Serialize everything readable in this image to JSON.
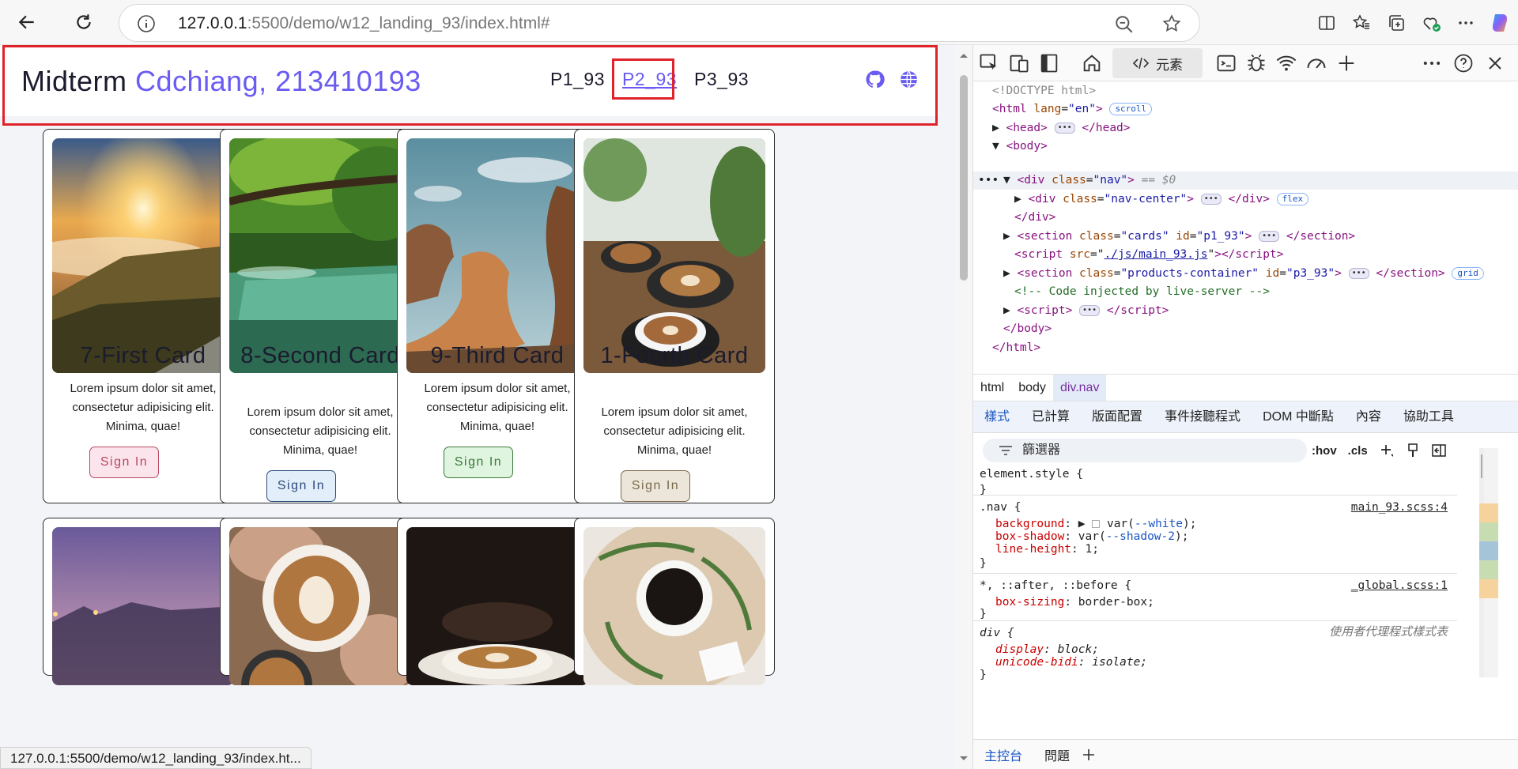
{
  "browser": {
    "url_host": "127.0.0.1",
    "url_rest": ":5500/demo/w12_landing_93/index.html#",
    "status_url": "127.0.0.1:5500/demo/w12_landing_93/index.ht..."
  },
  "page": {
    "brand_prefix": "Midterm",
    "brand_accent": "Cdchiang, 213410193",
    "nav_links": [
      "P1_93",
      "P2_93",
      "P3_93"
    ],
    "active_link": "P2_93",
    "accent_color": "#6a5bf2",
    "cards": [
      {
        "title": "7-First Card",
        "desc": "Lorem ipsum dolor sit amet, consectetur adipisicing elit. Minima, quae!",
        "button": "Sign In",
        "button_color": "#fbe4ec"
      },
      {
        "title": "8-Second Card",
        "desc": "Lorem ipsum dolor sit amet, consectetur adipisicing elit. Minima, quae!",
        "button": "Sign In",
        "button_color": "#e3eefb"
      },
      {
        "title": "9-Third Card",
        "desc": "Lorem ipsum dolor sit amet, consectetur adipisicing elit. Minima, quae!",
        "button": "Sign In",
        "button_color": "#e0f5e0"
      },
      {
        "title": "1-Fourth Card",
        "desc": "Lorem ipsum dolor sit amet, consectetur adipisicing elit. Minima, quae!",
        "button": "Sign In",
        "button_color": "#ece6da"
      }
    ]
  },
  "devtools": {
    "tab_elements": "元素",
    "tree": {
      "doctype": "<!DOCTYPE html>",
      "html_open_tag": "html",
      "html_lang_attr": "lang",
      "html_lang_val": "\"en\"",
      "badge_scroll": "scroll",
      "head": "head",
      "body": "body",
      "div_nav_class": "\"nav\"",
      "eq_s0": "== $0",
      "nav_center_class": "\"nav-center\"",
      "badge_flex": "flex",
      "section_cards_class": "\"cards\"",
      "section_cards_id": "\"p1_93\"",
      "script_src": "./js/main_93.js",
      "section_products_class": "\"products-container\"",
      "section_products_id": "\"p3_93\"",
      "badge_grid": "grid",
      "comment": "<!-- Code injected by live-server -->"
    },
    "breadcrumbs": [
      "html",
      "body",
      "div.nav"
    ],
    "subtabs": [
      "樣式",
      "已計算",
      "版面配置",
      "事件接聽程式",
      "DOM 中斷點",
      "內容",
      "協助工具"
    ],
    "filter_placeholder": "篩選器",
    "filter_hov": ":hov",
    "filter_cls": ".cls",
    "styles": {
      "element_style": "element.style {",
      "nav_selector": ".nav {",
      "nav_source": "main_93.scss:4",
      "nav_props": [
        {
          "name": "background",
          "value": "var(--white)"
        },
        {
          "name": "box-shadow",
          "value": "var(--shadow-2)"
        },
        {
          "name": "line-height",
          "value": "1"
        }
      ],
      "universal_selector": "*, ::after, ::before {",
      "universal_source": "_global.scss:1",
      "universal_prop": {
        "name": "box-sizing",
        "value": "border-box"
      },
      "div_selector": "div {",
      "ua_label": "使用者代理程式樣式表",
      "div_props": [
        {
          "name": "display",
          "value": "block"
        },
        {
          "name": "unicode-bidi",
          "value": "isolate"
        }
      ]
    },
    "bottom_tabs": [
      "主控台",
      "問題"
    ]
  }
}
